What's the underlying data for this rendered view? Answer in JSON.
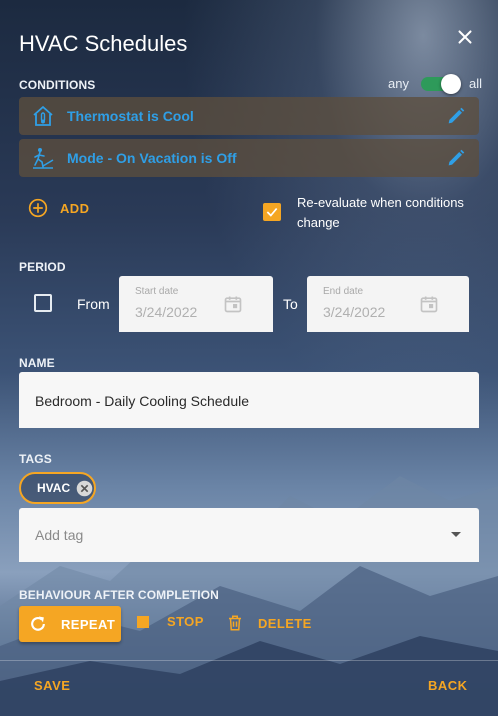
{
  "dialog": {
    "title": "HVAC Schedules"
  },
  "conditions": {
    "heading": "CONDITIONS",
    "toggle_any": "any",
    "toggle_all": "all",
    "toggle_state": "all",
    "items": [
      {
        "label": "Thermostat is Cool",
        "icon": "home-thermostat-icon"
      },
      {
        "label": "Mode - On Vacation is Off",
        "icon": "beach-vacation-icon"
      }
    ],
    "add_label": "ADD",
    "reevaluate_label": "Re-evaluate when conditions change",
    "reevaluate_checked": true
  },
  "period": {
    "heading": "PERIOD",
    "enabled": false,
    "from_label": "From",
    "to_label": "To",
    "start": {
      "label": "Start date",
      "value": "3/24/2022"
    },
    "end": {
      "label": "End date",
      "value": "3/24/2022"
    }
  },
  "name": {
    "heading": "NAME",
    "value": "Bedroom - Daily Cooling Schedule"
  },
  "tags": {
    "heading": "TAGS",
    "chips": [
      "HVAC"
    ],
    "placeholder": "Add tag"
  },
  "behaviour": {
    "heading": "BEHAVIOUR AFTER COMPLETION",
    "selected": "REPEAT",
    "repeat_label": "REPEAT",
    "stop_label": "STOP",
    "delete_label": "DELETE"
  },
  "footer": {
    "save_label": "SAVE",
    "back_label": "BACK"
  },
  "colors": {
    "accent": "#f5a623",
    "condition_text": "#2f9fe6",
    "toggle_on": "#2e9a5a"
  }
}
